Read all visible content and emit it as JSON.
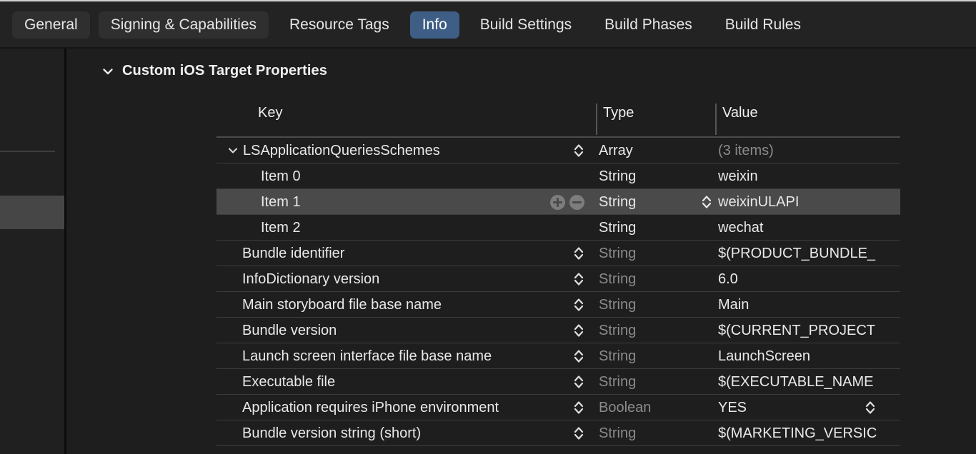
{
  "tabs": [
    {
      "label": "General",
      "style": "chip"
    },
    {
      "label": "Signing & Capabilities",
      "style": "chip"
    },
    {
      "label": "Resource Tags",
      "style": "plain"
    },
    {
      "label": "Info",
      "style": "active"
    },
    {
      "label": "Build Settings",
      "style": "plain"
    },
    {
      "label": "Build Phases",
      "style": "plain"
    },
    {
      "label": "Build Rules",
      "style": "plain"
    }
  ],
  "section": {
    "title": "Custom iOS Target Properties",
    "disclosure_icon": "chevron-down-icon"
  },
  "table": {
    "columns": {
      "key": "Key",
      "type": "Type",
      "value": "Value"
    },
    "rows": [
      {
        "key": "LSApplicationQueriesSchemes",
        "type": "Array",
        "value": "(3 items)",
        "indent": 0,
        "disclosure": "chevron-down-icon",
        "key_stepper": true,
        "type_dim": false,
        "value_dim": true,
        "value_stepper": false,
        "selected": false,
        "plus_minus": false
      },
      {
        "key": "Item 0",
        "type": "String",
        "value": "weixin",
        "indent": 2,
        "disclosure": null,
        "key_stepper": false,
        "type_dim": false,
        "value_dim": false,
        "value_stepper": false,
        "selected": false,
        "plus_minus": false
      },
      {
        "key": "Item 1",
        "type": "String",
        "value": "weixinULAPI",
        "indent": 2,
        "disclosure": null,
        "key_stepper": false,
        "type_dim": false,
        "value_dim": false,
        "value_stepper": true,
        "selected": true,
        "plus_minus": true
      },
      {
        "key": "Item 2",
        "type": "String",
        "value": "wechat",
        "indent": 2,
        "disclosure": null,
        "key_stepper": false,
        "type_dim": false,
        "value_dim": false,
        "value_stepper": false,
        "selected": false,
        "plus_minus": false
      },
      {
        "key": "Bundle identifier",
        "type": "String",
        "value": "$(PRODUCT_BUNDLE_",
        "indent": 1,
        "disclosure": null,
        "key_stepper": true,
        "type_dim": true,
        "value_dim": false,
        "value_stepper": false,
        "selected": false,
        "plus_minus": false
      },
      {
        "key": "InfoDictionary version",
        "type": "String",
        "value": "6.0",
        "indent": 1,
        "disclosure": null,
        "key_stepper": true,
        "type_dim": true,
        "value_dim": false,
        "value_stepper": false,
        "selected": false,
        "plus_minus": false
      },
      {
        "key": "Main storyboard file base name",
        "type": "String",
        "value": "Main",
        "indent": 1,
        "disclosure": null,
        "key_stepper": true,
        "type_dim": true,
        "value_dim": false,
        "value_stepper": false,
        "selected": false,
        "plus_minus": false
      },
      {
        "key": "Bundle version",
        "type": "String",
        "value": "$(CURRENT_PROJECT",
        "indent": 1,
        "disclosure": null,
        "key_stepper": true,
        "type_dim": true,
        "value_dim": false,
        "value_stepper": false,
        "selected": false,
        "plus_minus": false
      },
      {
        "key": "Launch screen interface file base name",
        "type": "String",
        "value": "LaunchScreen",
        "indent": 1,
        "disclosure": null,
        "key_stepper": true,
        "type_dim": true,
        "value_dim": false,
        "value_stepper": false,
        "selected": false,
        "plus_minus": false
      },
      {
        "key": "Executable file",
        "type": "String",
        "value": "$(EXECUTABLE_NAME",
        "indent": 1,
        "disclosure": null,
        "key_stepper": true,
        "type_dim": true,
        "value_dim": false,
        "value_stepper": false,
        "selected": false,
        "plus_minus": false
      },
      {
        "key": "Application requires iPhone environment",
        "type": "Boolean",
        "value": "YES",
        "indent": 1,
        "disclosure": null,
        "key_stepper": true,
        "type_dim": true,
        "value_dim": false,
        "value_stepper": true,
        "selected": false,
        "plus_minus": false
      },
      {
        "key": "Bundle version string (short)",
        "type": "String",
        "value": "$(MARKETING_VERSIC",
        "indent": 1,
        "disclosure": null,
        "key_stepper": true,
        "type_dim": true,
        "value_dim": false,
        "value_stepper": false,
        "selected": false,
        "plus_minus": false
      }
    ]
  },
  "colors": {
    "accent": "#3f5e85",
    "background": "#1e1e1e",
    "selection": "#4a4a4a"
  }
}
